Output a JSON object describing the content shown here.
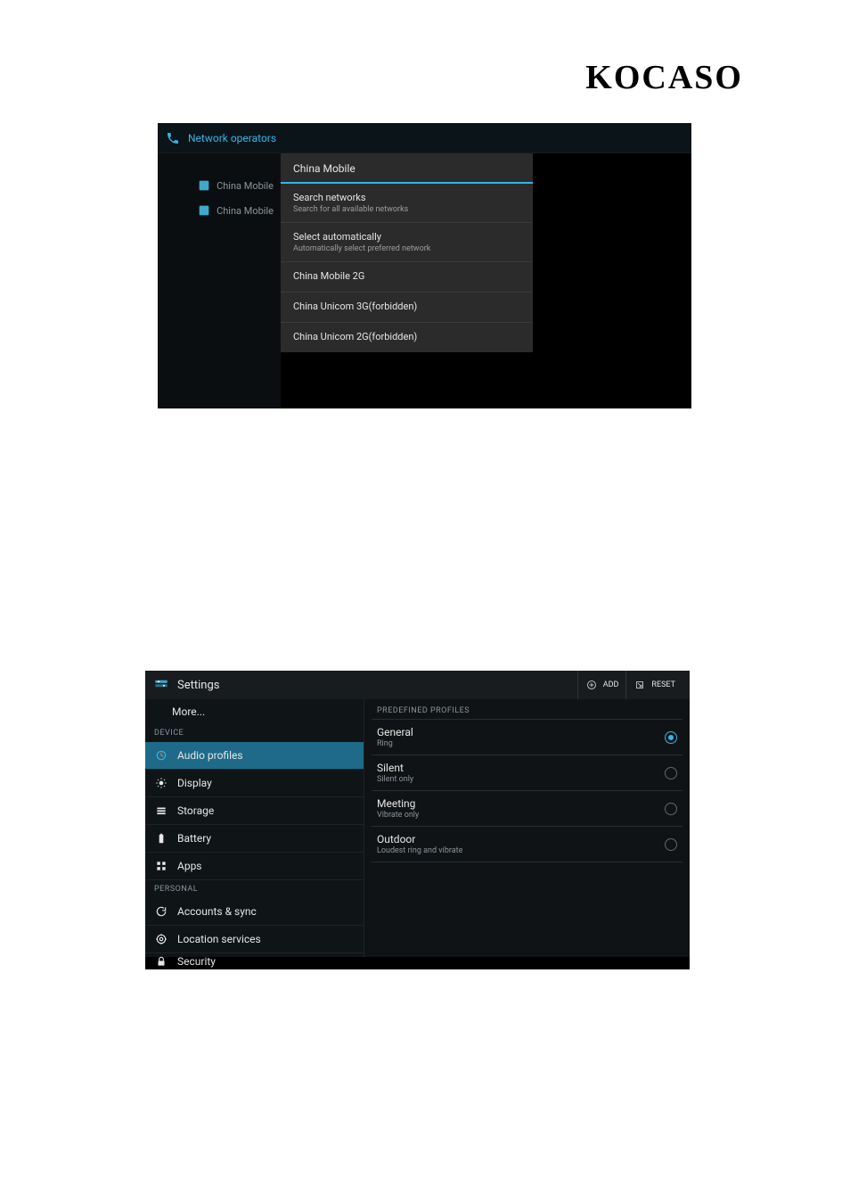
{
  "brand": "KOCASO",
  "screenshot1": {
    "header_title": "Network operators",
    "left_items": [
      {
        "label": "China Mobile"
      },
      {
        "label": "China Mobile"
      }
    ],
    "panel_title": "China Mobile",
    "panel_items": [
      {
        "primary": "Search networks",
        "secondary": "Search for all available networks"
      },
      {
        "primary": "Select automatically",
        "secondary": "Automatically select preferred network"
      },
      {
        "primary": "China Mobile 2G",
        "secondary": ""
      },
      {
        "primary": "China Unicom 3G(forbidden)",
        "secondary": ""
      },
      {
        "primary": "China Unicom 2G(forbidden)",
        "secondary": ""
      }
    ]
  },
  "screenshot2": {
    "header_title": "Settings",
    "actions": {
      "add": "ADD",
      "reset": "RESET"
    },
    "left": {
      "more": "More...",
      "sections": {
        "device": "DEVICE",
        "personal": "PERSONAL"
      },
      "items": {
        "audio_profiles": "Audio profiles",
        "display": "Display",
        "storage": "Storage",
        "battery": "Battery",
        "apps": "Apps",
        "accounts_sync": "Accounts & sync",
        "location_services": "Location services",
        "security": "Security"
      }
    },
    "right": {
      "section": "PREDEFINED PROFILES",
      "profiles": [
        {
          "primary": "General",
          "secondary": "Ring",
          "selected": true
        },
        {
          "primary": "Silent",
          "secondary": "Silent only",
          "selected": false
        },
        {
          "primary": "Meeting",
          "secondary": "Vibrate only",
          "selected": false
        },
        {
          "primary": "Outdoor",
          "secondary": "Loudest ring and vibrate",
          "selected": false
        }
      ]
    }
  }
}
